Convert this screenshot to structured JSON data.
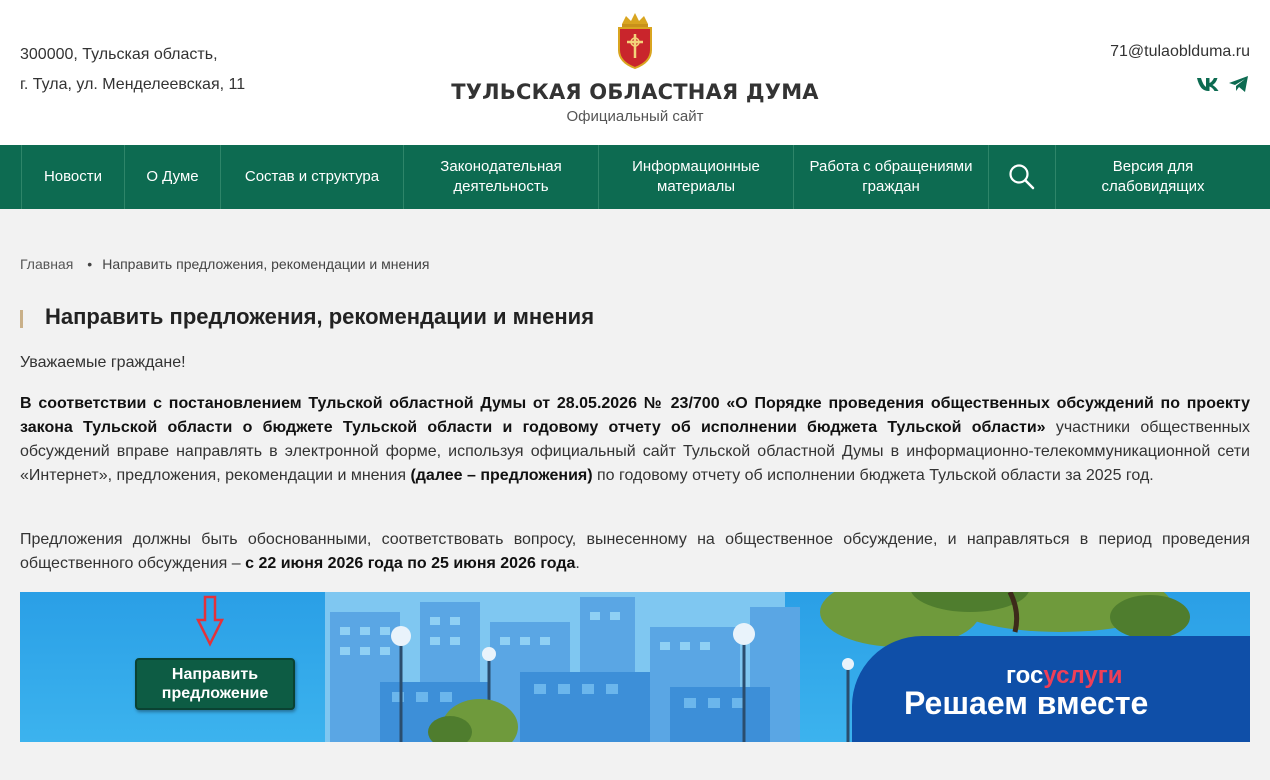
{
  "header": {
    "address_line1": "300000, Тульская область,",
    "address_line2": "г. Тула, ул. Менделеевская, 11",
    "title": "ТУЛЬСКАЯ ОБЛАСТНАЯ ДУМА",
    "subtitle": "Официальный сайт",
    "email": "71@tulaoblduma.ru",
    "socials": [
      "vk-icon",
      "telegram-icon"
    ]
  },
  "nav": {
    "items": [
      {
        "label": "Новости"
      },
      {
        "label": "О Думе"
      },
      {
        "label": "Состав и структура"
      },
      {
        "label": "Законодательная деятельность"
      },
      {
        "label": "Информационные материалы"
      },
      {
        "label": "Работа с обращениями граждан"
      },
      {
        "label": ""
      },
      {
        "label": "Версия для слабовидящих"
      }
    ],
    "search_icon": "search-icon"
  },
  "breadcrumb": {
    "home": "Главная",
    "current": "Направить предложения, рекомендации и мнения"
  },
  "page": {
    "title": "Направить предложения, рекомендации и мнения",
    "greeting": "Уважаемые граждане!",
    "p1_bold": "В соответствии с постановлением Тульской областной Думы от 28.05.2026 № 23/700 «О Порядке проведения общественных обсуждений по проекту закона Тульской области о бюджете Тульской области и годовому отчету об исполнении бюджета Тульской области»",
    "p1_text": " участники общественных обсуждений вправе направлять в электронной форме, используя официальный сайт Тульской областной Думы в информационно-телекоммуникационной сети «Интернет», предложения, рекомендации и мнения ",
    "p1_bold2": "(далее – предложения)",
    "p1_text2": " по годовому отчету об исполнении бюджета Тульской области за 2025 год.",
    "p2_text": "Предложения должны быть обоснованными, соответствовать вопросу, вынесенному на общественное обсуждение, и направляться в период проведения общественного обсуждения – ",
    "p2_bold": "с 22 июня 2026 года по 25 июня 2026 года",
    "p2_end": "."
  },
  "banner": {
    "button_label_1": "Направить",
    "button_label_2": "предложение",
    "logo_part1": "гос",
    "logo_part2": "услуги",
    "slogan": "Решаем вместе"
  },
  "colors": {
    "nav_bg": "#0d6b51",
    "banner_sky": "#2fa8e8",
    "gos_panel": "#0f4fa8",
    "gos_red": "#ee3f58"
  }
}
